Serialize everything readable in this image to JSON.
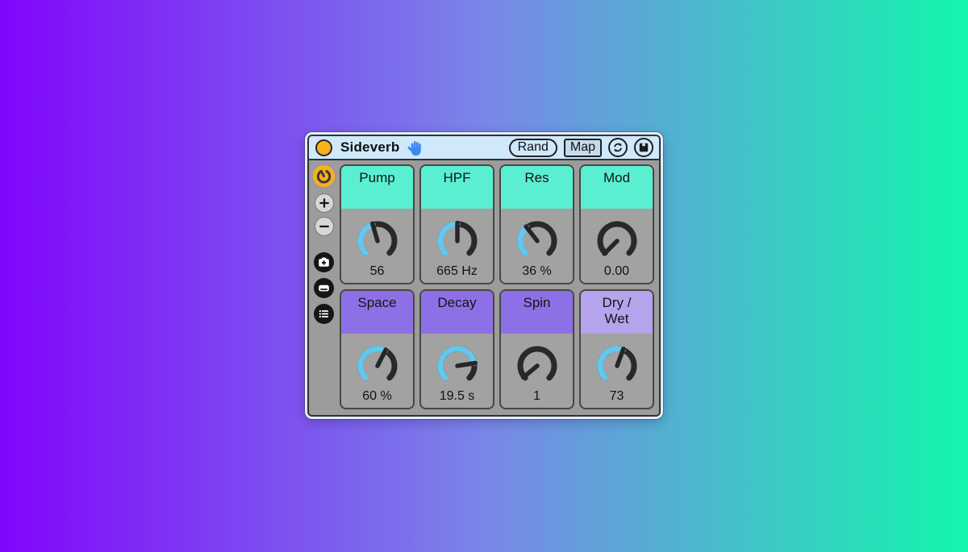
{
  "device": {
    "title": "Sideverb",
    "activator_state": "on"
  },
  "titlebar": {
    "rand_label": "Rand",
    "map_label": "Map",
    "icons": [
      "hand-icon",
      "randomize-cycle-icon",
      "save-icon"
    ]
  },
  "sidebar": {
    "icons": [
      "macro-knob-toggle-icon",
      "add-macro-icon",
      "remove-macro-icon",
      "new-variation-camera-icon",
      "variations-panel-icon",
      "chain-list-icon"
    ]
  },
  "macros": [
    {
      "name": "Pump",
      "value": "56",
      "fraction": 0.44,
      "header_color": "#5BEFD2"
    },
    {
      "name": "HPF",
      "value": "665 Hz",
      "fraction": 0.5,
      "header_color": "#5BEFD2"
    },
    {
      "name": "Res",
      "value": "36 %",
      "fraction": 0.36,
      "header_color": "#5BEFD2"
    },
    {
      "name": "Mod",
      "value": "0.00",
      "fraction": 0.0,
      "header_color": "#5BEFD2"
    },
    {
      "name": "Space",
      "value": "60 %",
      "fraction": 0.6,
      "header_color": "#8D70E6"
    },
    {
      "name": "Decay",
      "value": "19.5 s",
      "fraction": 0.8,
      "header_color": "#8D70E6"
    },
    {
      "name": "Spin",
      "value": "1",
      "fraction": 0.02,
      "header_color": "#8D70E6"
    },
    {
      "name": "Dry / Wet",
      "value": "73",
      "fraction": 0.575,
      "header_color": "#B5A3EC"
    }
  ],
  "colors": {
    "bg_gradient_left": "#8105FB",
    "bg_gradient_right": "#13F6AD",
    "titlebar_bg": "#CFE9FB",
    "panel_gray": "#9C9C9C",
    "activator_orange": "#F9B019",
    "hand_blue": "#3E87F2",
    "knob_track": "#292929",
    "knob_value": "#62C8EF",
    "knob_needle": "#262626",
    "header_cyan": "#5BEFD2",
    "header_purple": "#8D70E6",
    "header_light_purple": "#B5A3EC"
  }
}
